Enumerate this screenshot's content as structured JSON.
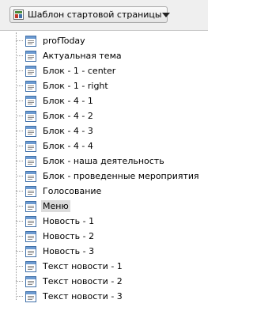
{
  "toolbar": {
    "template_selector": {
      "value": "Шаблон стартовой страницы",
      "icon": "page-template-icon"
    }
  },
  "tree": {
    "items": [
      {
        "label": "profToday",
        "icon": "web-page-icon"
      },
      {
        "label": "Актуальная тема",
        "icon": "web-page-icon"
      },
      {
        "label": "Блок - 1 - center",
        "icon": "web-page-icon"
      },
      {
        "label": "Блок - 1 - right",
        "icon": "web-page-icon"
      },
      {
        "label": "Блок - 4 - 1",
        "icon": "web-page-icon"
      },
      {
        "label": "Блок - 4 - 2",
        "icon": "web-page-icon"
      },
      {
        "label": "Блок - 4 - 3",
        "icon": "web-page-icon"
      },
      {
        "label": "Блок - 4 - 4",
        "icon": "web-page-icon"
      },
      {
        "label": "Блок - наша деятельность",
        "icon": "web-page-icon"
      },
      {
        "label": "Блок - проведенные мероприятия",
        "icon": "web-page-icon"
      },
      {
        "label": "Голосование",
        "icon": "web-page-icon"
      },
      {
        "label": "Меню",
        "icon": "web-page-icon",
        "selected": true
      },
      {
        "label": "Новость - 1",
        "icon": "web-page-icon"
      },
      {
        "label": "Новость - 2",
        "icon": "web-page-icon"
      },
      {
        "label": "Новость - 3",
        "icon": "web-page-icon"
      },
      {
        "label": "Текст новости - 1",
        "icon": "web-page-icon"
      },
      {
        "label": "Текст новости - 2",
        "icon": "web-page-icon"
      },
      {
        "label": "Текст новости - 3",
        "icon": "web-page-icon"
      }
    ]
  },
  "colors": {
    "selection_background": "#dcdcdc",
    "icon_frame": "#3f6fa8"
  }
}
